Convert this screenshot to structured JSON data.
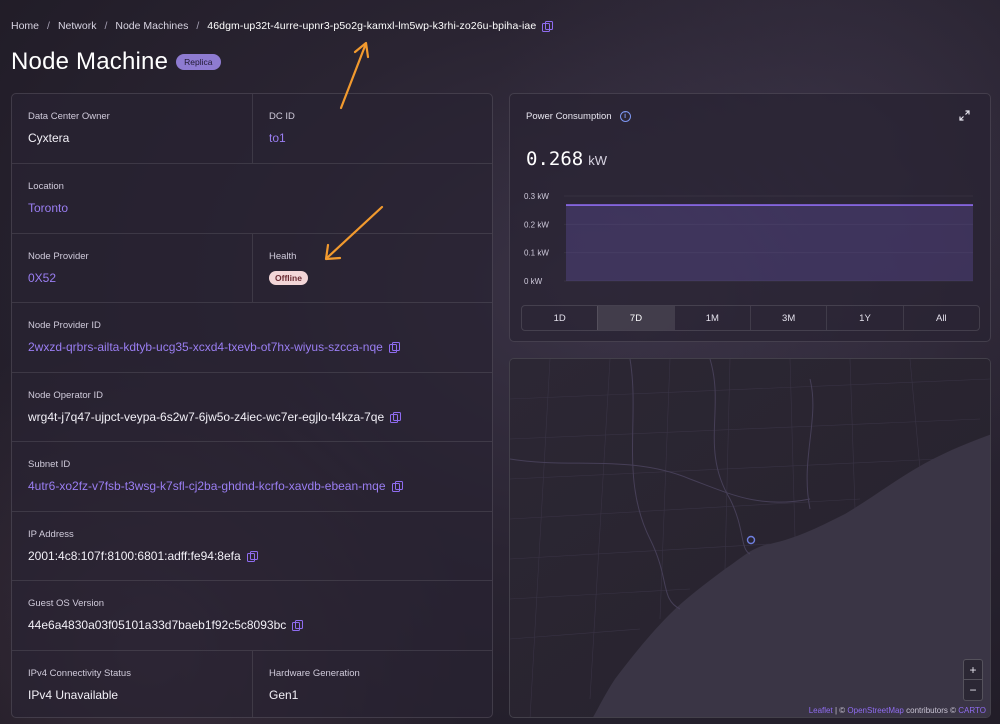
{
  "breadcrumb": {
    "home": "Home",
    "network": "Network",
    "node_machines": "Node Machines",
    "current": "46dgm-up32t-4urre-upnr3-p5o2g-kamxl-lm5wp-k3rhi-zo26u-bpiha-iae",
    "separator": "/"
  },
  "header": {
    "title": "Node Machine",
    "badge": "Replica"
  },
  "details": {
    "dc_owner_label": "Data Center Owner",
    "dc_owner": "Cyxtera",
    "dc_id_label": "DC ID",
    "dc_id": "to1",
    "location_label": "Location",
    "location": "Toronto",
    "node_provider_label": "Node Provider",
    "node_provider": "0X52",
    "health_label": "Health",
    "health": "Offline",
    "node_provider_id_label": "Node Provider ID",
    "node_provider_id": "2wxzd-qrbrs-ailta-kdtyb-ucg35-xcxd4-txevb-ot7hx-wiyus-szcca-nqe",
    "node_operator_id_label": "Node Operator ID",
    "node_operator_id": "wrg4t-j7q47-ujpct-veypa-6s2w7-6jw5o-z4iec-wc7er-egjlo-t4kza-7qe",
    "subnet_id_label": "Subnet ID",
    "subnet_id": "4utr6-xo2fz-v7fsb-t3wsg-k7sfl-cj2ba-ghdnd-kcrfo-xavdb-ebean-mqe",
    "ip_label": "IP Address",
    "ip": "2001:4c8:107f:8100:6801:adff:fe94:8efa",
    "guest_os_label": "Guest OS Version",
    "guest_os": "44e6a4830a03f05101a33d7baeb1f92c5c8093bc",
    "ipv4_label": "IPv4 Connectivity Status",
    "ipv4": "IPv4 Unavailable",
    "hw_label": "Hardware Generation",
    "hw": "Gen1"
  },
  "power": {
    "title": "Power Consumption",
    "info": "i",
    "value": "0.268",
    "unit": "kW",
    "ranges": [
      "1D",
      "7D",
      "1M",
      "3M",
      "1Y",
      "All"
    ],
    "active_range": "7D"
  },
  "chart_data": {
    "type": "area",
    "y_ticks": [
      "0.3 kW",
      "0.2 kW",
      "0.1 kW",
      "0 kW"
    ],
    "ylim": [
      0,
      0.3
    ],
    "values": [
      0.268,
      0.268,
      0.268,
      0.268,
      0.268,
      0.268,
      0.268,
      0.268
    ],
    "color": "#8f6cf0",
    "grid": true
  },
  "map": {
    "zoom_in": "+",
    "zoom_out": "−",
    "attribution_leaflet": "Leaflet",
    "attribution_sep": "| ©",
    "attribution_osm": "OpenStreetMap",
    "attribution_mid": "contributors ©",
    "attribution_carto": "CARTO"
  },
  "colors": {
    "accent": "#8f6cf0",
    "arrow": "#f29a2e",
    "offline_bg": "#f3d6d8"
  }
}
